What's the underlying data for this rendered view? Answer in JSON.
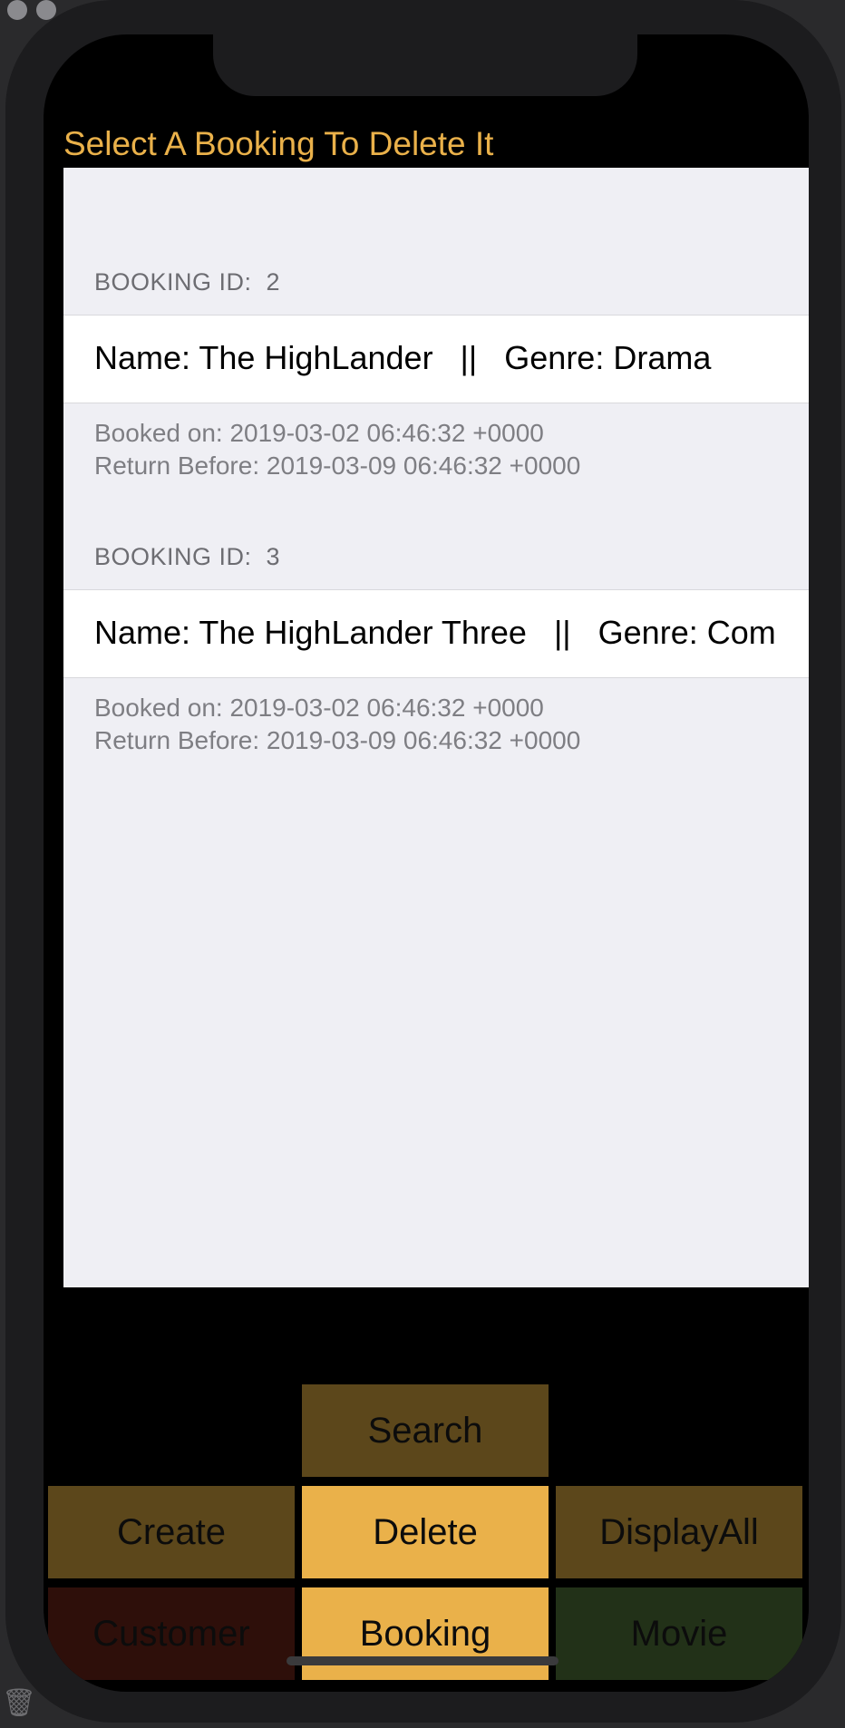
{
  "screen": {
    "title": "Select A Booking To Delete It"
  },
  "bookings": [
    {
      "header": "BOOKING ID:  2",
      "title": "Name: The HighLander   ||   Genre: Drama",
      "booked_on": "Booked on: 2019-03-02 06:46:32 +0000",
      "return_before": "Return Before: 2019-03-09 06:46:32 +0000"
    },
    {
      "header": "BOOKING ID:  3",
      "title": "Name: The HighLander Three   ||   Genre: Com",
      "booked_on": "Booked on: 2019-03-02 06:46:32 +0000",
      "return_before": "Return Before: 2019-03-09 06:46:32 +0000"
    }
  ],
  "actions": {
    "search": "Search",
    "create": "Create",
    "delete": "Delete",
    "display_all": "DisplayAll"
  },
  "entities": {
    "customer": "Customer",
    "booking": "Booking",
    "movie": "Movie"
  },
  "colors": {
    "accent": "#eab14a",
    "dimmed_button": "#5c471b",
    "customer_button": "#2e0f0a",
    "movie_button": "#223118",
    "table_background": "#efeff4"
  },
  "icons": {
    "trash": "trash-icon"
  }
}
